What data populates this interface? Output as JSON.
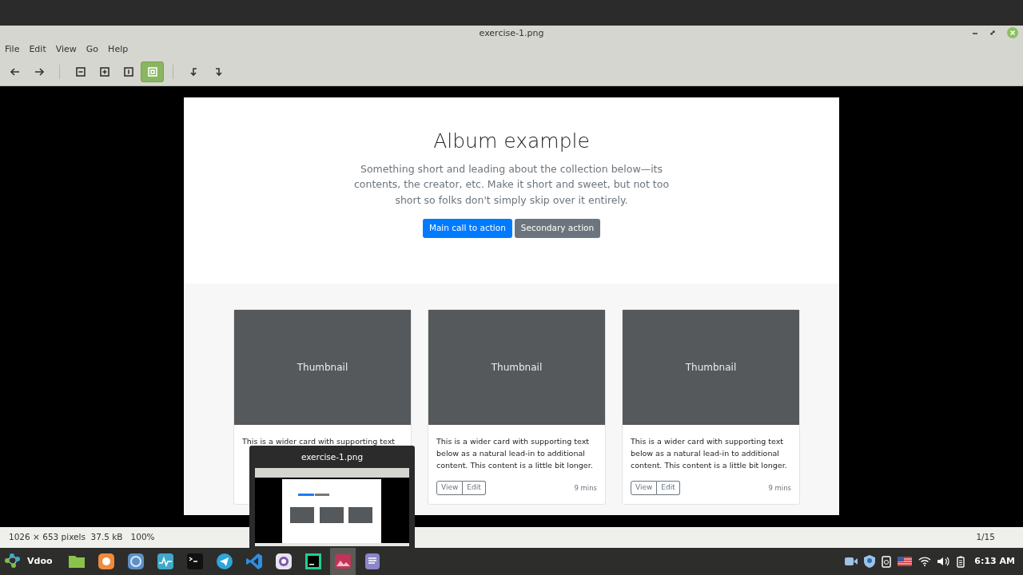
{
  "window": {
    "title": "exercise-1.png"
  },
  "menu": [
    "File",
    "Edit",
    "View",
    "Go",
    "Help"
  ],
  "toolbar": [
    [
      {
        "kind": "back"
      },
      {
        "kind": "forward"
      }
    ],
    [
      {
        "kind": "zoom-out"
      },
      {
        "kind": "zoom-in"
      },
      {
        "kind": "actual",
        "selected": false
      },
      {
        "kind": "fit",
        "selected": true
      }
    ],
    [
      {
        "kind": "rotate-left"
      },
      {
        "kind": "rotate-right"
      }
    ]
  ],
  "image": {
    "hero": {
      "title": "Album example",
      "lead": "Something short and leading about the collection below—its contents, the creator, etc. Make it short and sweet, but not too short so folks don't simply skip over it entirely.",
      "primary": "Main call to action",
      "secondary": "Secondary action"
    },
    "cards": [
      {
        "thumbnail": "Thumbnail",
        "lines": [
          "This is a wider card with supporting text"
        ]
      },
      {
        "thumbnail": "Thumbnail",
        "lines": [
          "This is a wider card with supporting text",
          "below as a natural lead-in to additional",
          "content. This content is a little bit longer."
        ],
        "view": "View",
        "edit": "Edit",
        "time": "9 mins"
      },
      {
        "thumbnail": "Thumbnail",
        "lines": [
          "This is a wider card with supporting text",
          "below as a natural lead-in to additional",
          "content. This content is a little bit longer."
        ],
        "view": "View",
        "edit": "Edit",
        "time": "9 mins"
      }
    ]
  },
  "status_bar": {
    "info": "1026 × 653 pixels  37.5 kB   100%",
    "page": "1/15"
  },
  "preview_popup": {
    "title": "exercise-1.png"
  },
  "taskbar": {
    "menu_label": "Vdoo",
    "apps": [
      {
        "kind": "files",
        "selected": false
      },
      {
        "kind": "firefox",
        "selected": false
      },
      {
        "kind": "chrome",
        "selected": false
      },
      {
        "kind": "monitor",
        "selected": false
      },
      {
        "kind": "terminal",
        "selected": false
      },
      {
        "kind": "telegram",
        "selected": false
      },
      {
        "kind": "vscode",
        "selected": false
      },
      {
        "kind": "camera",
        "selected": false
      },
      {
        "kind": "pycharm",
        "selected": false
      },
      {
        "kind": "viewer",
        "selected": true
      },
      {
        "kind": "notes",
        "selected": false
      }
    ],
    "clock": "6:13 AM"
  }
}
